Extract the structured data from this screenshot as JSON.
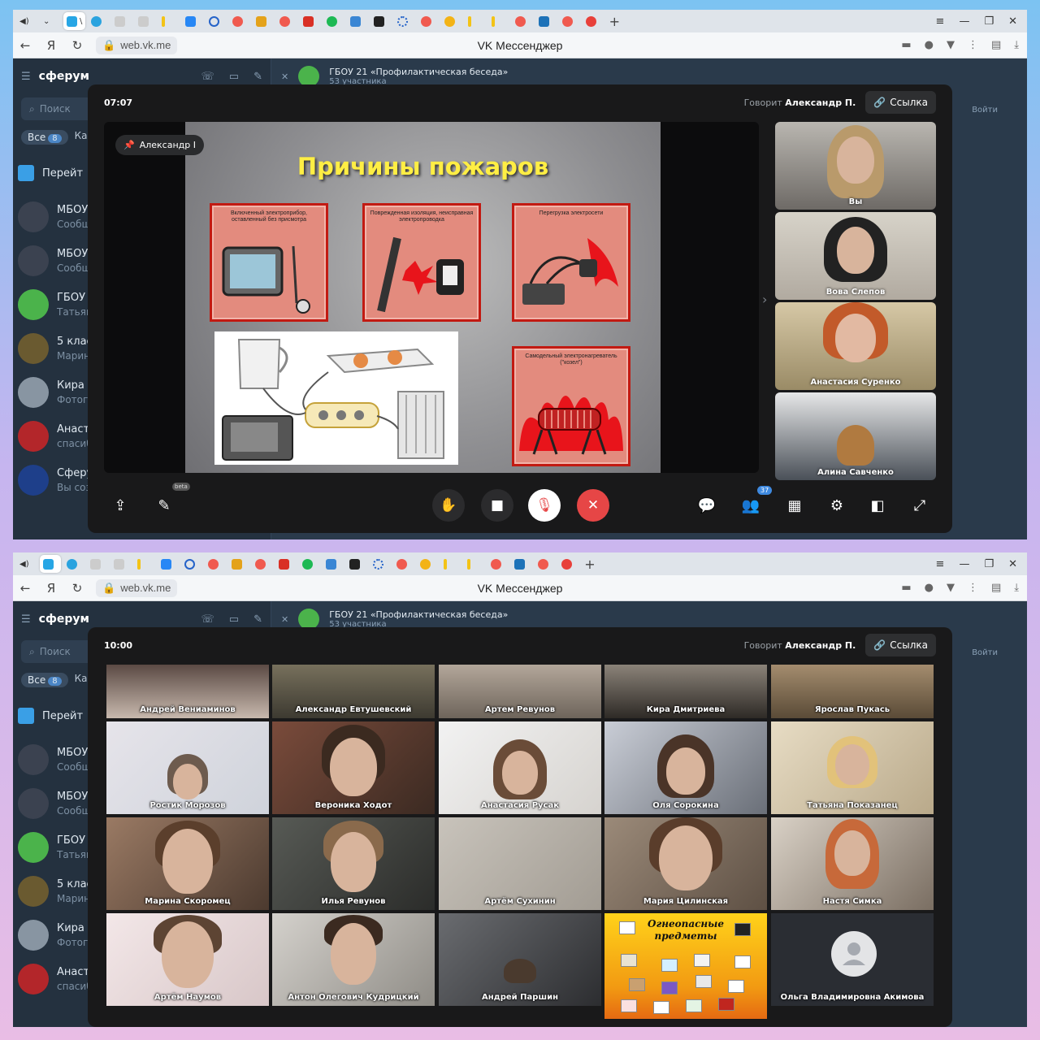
{
  "screens": [
    {
      "tabs_first_label": "\\",
      "url": "web.vk.me",
      "page_title": "VK Мессенджер",
      "app_name": "сферум",
      "search_placeholder": "Поиск",
      "filter_all": "Все",
      "filter_all_count": "8",
      "filter_channels": "Кана",
      "go_label": "Перейт",
      "chats": [
        {
          "name": "МБОУ",
          "preview": "Сообщ"
        },
        {
          "name": "МБОУ",
          "preview": "Сообщ"
        },
        {
          "name": "ГБОУ 2",
          "preview": "Татьян"
        },
        {
          "name": "5 клас",
          "preview": "Марин"
        },
        {
          "name": "Кира Д",
          "preview": "Фотогр"
        },
        {
          "name": "Анаст",
          "preview": "спасиб"
        },
        {
          "name": "Сферу",
          "preview": "Вы соз"
        }
      ],
      "chat_title": "ГБОУ 21 «Профилактическая беседа»",
      "chat_members": "53 участника",
      "login": "Войти",
      "call": {
        "time": "07:07",
        "speaker_prefix": "Говорит",
        "speaker_name": "Александр П.",
        "link_label": "Ссылка",
        "pinned_name": "Александр I",
        "slide": {
          "title": "Причины пожаров",
          "panel1": "Включенный электроприбор, оставленный без присмотра",
          "panel2": "Поврежденная изоляция, неисправная электропроводка",
          "panel3": "Перегрузка электросети",
          "panel4": "Самодельный электронагреватель (\"козел\")"
        },
        "participants": [
          "Вы",
          "Вова Слепов",
          "Анастасия Суренко",
          "Алина Савченко"
        ],
        "beta_label": "beta",
        "participants_count": "37"
      }
    },
    {
      "url": "web.vk.me",
      "page_title": "VK Мессенджер",
      "app_name": "сферум",
      "search_placeholder": "Поиск",
      "filter_all": "Все",
      "filter_all_count": "8",
      "filter_channels": "Кана",
      "go_label": "Перейт",
      "chats": [
        {
          "name": "МБОУ",
          "preview": "Сообщ"
        },
        {
          "name": "МБОУ",
          "preview": "Сообщ"
        },
        {
          "name": "ГБОУ 2",
          "preview": "Татьян"
        },
        {
          "name": "5 клас",
          "preview": "Марин"
        },
        {
          "name": "Кира Д",
          "preview": "Фотогр"
        },
        {
          "name": "Анаст",
          "preview": "спасиб"
        }
      ],
      "chat_title": "ГБОУ 21 «Профилактическая беседа»",
      "chat_members": "53 участника",
      "login": "Войти",
      "call": {
        "time": "10:00",
        "speaker_prefix": "Говорит",
        "speaker_name": "Александр П.",
        "link_label": "Ссылка",
        "grid": [
          "Андрей Вениаминов",
          "Александр Евтушевский",
          "Артем Ревунов",
          "Кира Дмитриева",
          "Ярослав Пукась",
          "Ростик Морозов",
          "Вероника Ходот",
          "Анастасия Русак",
          "Оля Сорокина",
          "Татьяна Показанец",
          "Марина Скоромец",
          "Илья Ревунов",
          "Артём Сухинин",
          "Мария Цилинская",
          "Настя Симка",
          "Артём Наумов",
          "Антон Олегович Кудрицкий",
          "Андрей Паршин",
          "",
          "Ольга Владимировна Акимова"
        ],
        "poster_title_1": "Огнеопасные",
        "poster_title_2": "предметы"
      }
    }
  ]
}
